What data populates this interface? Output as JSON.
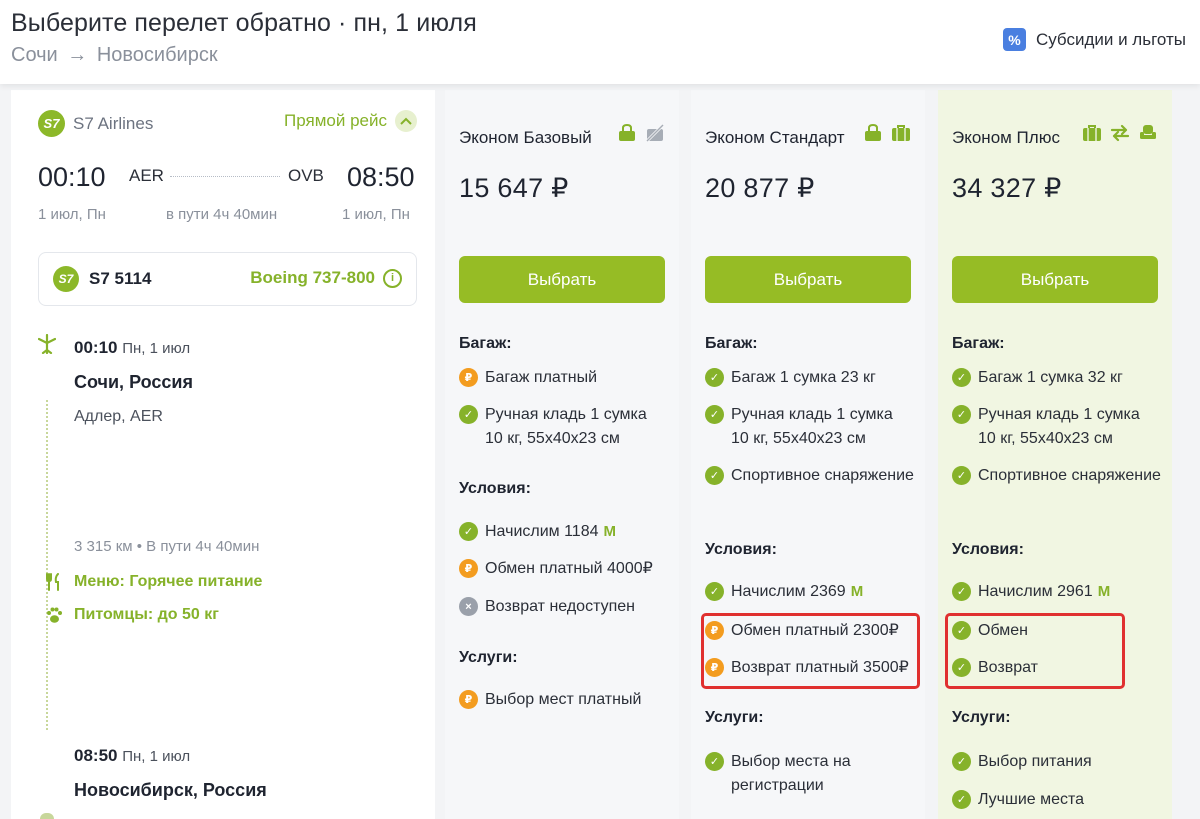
{
  "header": {
    "title": "Выберите перелет обратно · пн, 1 июля",
    "route_from": "Сочи",
    "route_arrow": "→",
    "route_to": "Новосибирск",
    "subsidy_badge": "%",
    "subsidy_label": "Субсидии и льготы"
  },
  "flight": {
    "logo_text": "S7",
    "airline": "S7 Airlines",
    "direct_label": "Прямой рейс",
    "dep_time": "00:10",
    "dep_code": "AER",
    "arr_code": "OVB",
    "arr_time": "08:50",
    "dep_date": "1 июл, Пн",
    "duration": "в пути 4ч 40мин",
    "arr_date": "1 июл, Пн",
    "flight_number": "S7 5114",
    "aircraft": "Boeing 737-800",
    "info_icon": "i",
    "segment": {
      "dep_time": "00:10",
      "dep_date": "Пн, 1 июл",
      "dep_city": "Сочи, Россия",
      "dep_port": "Адлер, AER",
      "meta": "3 315 км • В пути 4ч 40мин",
      "meal": "Меню: Горячее питание",
      "pets": "Питомцы: до 50 кг",
      "arr_time": "08:50",
      "arr_date": "Пн, 1 июл",
      "arr_city": "Новосибирск, Россия"
    }
  },
  "fares": [
    {
      "name": "Эконом Базовый",
      "price": "15 647 ₽",
      "button": "Выбрать",
      "baggage_title": "Багаж:",
      "baggage": [
        {
          "status": "paid",
          "text": "Багаж платный"
        },
        {
          "status": "ok",
          "text": "Ручная кладь 1 сумка 10 кг, 55x40x23 см"
        }
      ],
      "conditions_title": "Условия:",
      "conditions": [
        {
          "status": "ok",
          "text": "Начислим 1184"
        },
        {
          "status": "paid",
          "text": "Обмен платный 4000₽"
        },
        {
          "status": "no",
          "text": "Возврат недоступен"
        }
      ],
      "services_title": "Услуги:",
      "services": [
        {
          "status": "paid",
          "text": "Выбор мест платный"
        }
      ]
    },
    {
      "name": "Эконом Стандарт",
      "price": "20 877 ₽",
      "button": "Выбрать",
      "baggage_title": "Багаж:",
      "baggage": [
        {
          "status": "ok",
          "text": "Багаж 1 сумка 23 кг"
        },
        {
          "status": "ok",
          "text": "Ручная кладь 1 сумка 10 кг, 55x40x23 см"
        },
        {
          "status": "ok",
          "text": "Спортивное снаряжение"
        }
      ],
      "conditions_title": "Условия:",
      "conditions": [
        {
          "status": "ok",
          "text": "Начислим 2369"
        },
        {
          "status": "paid",
          "text": "Обмен платный 2300₽"
        },
        {
          "status": "paid",
          "text": "Возврат платный 3500₽"
        }
      ],
      "services_title": "Услуги:",
      "services": [
        {
          "status": "ok",
          "text": "Выбор места на регистрации"
        }
      ]
    },
    {
      "name": "Эконом Плюс",
      "price": "34 327 ₽",
      "button": "Выбрать",
      "baggage_title": "Багаж:",
      "baggage": [
        {
          "status": "ok",
          "text": "Багаж 1 сумка 32 кг"
        },
        {
          "status": "ok",
          "text": "Ручная кладь 1 сумка 10 кг, 55x40x23 см"
        },
        {
          "status": "ok",
          "text": "Спортивное снаряжение"
        }
      ],
      "conditions_title": "Условия:",
      "conditions": [
        {
          "status": "ok",
          "text": "Начислим 2961"
        },
        {
          "status": "ok",
          "text": "Обмен"
        },
        {
          "status": "ok",
          "text": "Возврат"
        }
      ],
      "services_title": "Услуги:",
      "services": [
        {
          "status": "ok",
          "text": "Выбор питания"
        },
        {
          "status": "ok",
          "text": "Лучшие места"
        }
      ]
    }
  ],
  "miles_symbol": "M",
  "status_glyphs": {
    "ok": "✓",
    "paid": "₽",
    "no": "×"
  },
  "colors": {
    "accent": "#96bc25",
    "paid": "#f39c1f",
    "highlight": "#e0302f",
    "plus_bg": "#f1f6e2"
  }
}
